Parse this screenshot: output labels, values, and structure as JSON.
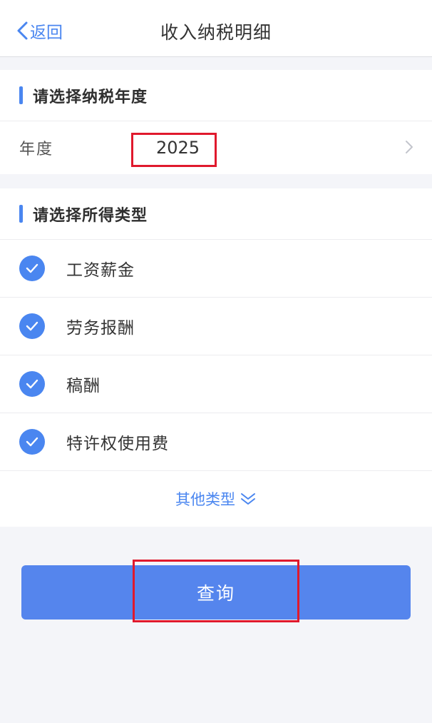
{
  "header": {
    "back_label": "返回",
    "title": "收入纳税明细"
  },
  "year_section": {
    "title": "请选择纳税年度",
    "label": "年度",
    "value": "2025"
  },
  "type_section": {
    "title": "请选择所得类型",
    "items": [
      {
        "label": "工资薪金",
        "checked": true
      },
      {
        "label": "劳务报酬",
        "checked": true
      },
      {
        "label": "稿酬",
        "checked": true
      },
      {
        "label": "特许权使用费",
        "checked": true
      }
    ],
    "more_label": "其他类型"
  },
  "query_button": {
    "label": "查询"
  },
  "colors": {
    "accent": "#4a86f0",
    "button": "#5585ed",
    "highlight": "#e0192d",
    "background": "#f4f5f9"
  },
  "icons": {
    "back": "chevron-left-icon",
    "year_arrow": "chevron-right-icon",
    "check": "check-circle-icon",
    "more": "double-chevron-down-icon"
  }
}
